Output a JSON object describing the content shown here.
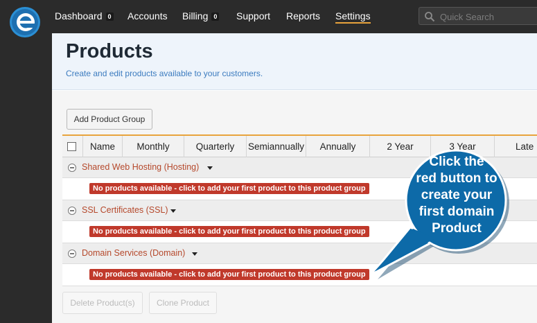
{
  "nav": {
    "items": [
      {
        "label": "Dashboard",
        "badge": "0"
      },
      {
        "label": "Accounts"
      },
      {
        "label": "Billing",
        "badge": "0"
      },
      {
        "label": "Support"
      },
      {
        "label": "Reports"
      },
      {
        "label": "Settings",
        "active": true
      }
    ],
    "search_placeholder": "Quick Search",
    "logo_icon": "e-logo-icon"
  },
  "page": {
    "title": "Products",
    "subtitle": "Create and edit products available to your customers."
  },
  "toolbar": {
    "add_group_label": "Add Product Group"
  },
  "table": {
    "columns": [
      "Name",
      "Monthly",
      "Quarterly",
      "Semiannually",
      "Annually",
      "2 Year",
      "3 Year",
      "Late"
    ],
    "groups": [
      {
        "name": "Shared Web Hosting (Hosting)",
        "empty_message": "No products available - click to add your first product to this product group"
      },
      {
        "name": "SSL Certificates (SSL)",
        "empty_message": "No products available - click to add your first product to this product group"
      },
      {
        "name": "Domain Services (Domain)",
        "empty_message": "No products available - click to add your first product to this product group"
      }
    ]
  },
  "actions": {
    "delete_label": "Delete Product(s)",
    "clone_label": "Clone Product"
  },
  "callout": {
    "lines": [
      "Click the",
      "red button to",
      "create your",
      "first domain",
      "Product"
    ]
  },
  "colors": {
    "accent": "#e8a33c",
    "link": "#b5482b",
    "add_button": "#c0392b",
    "callout": "#0d6aa8"
  }
}
